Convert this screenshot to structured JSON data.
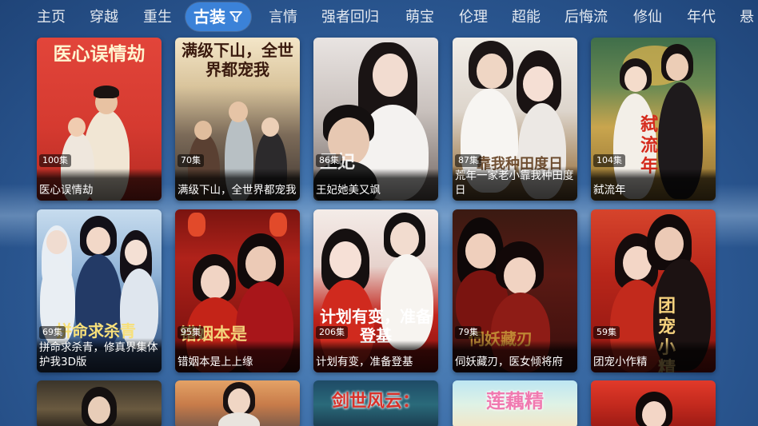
{
  "tabs": [
    {
      "label": "主页"
    },
    {
      "label": "穿越"
    },
    {
      "label": "重生"
    },
    {
      "label": "古装"
    },
    {
      "label": "言情"
    },
    {
      "label": "强者回归"
    },
    {
      "label": "萌宝"
    },
    {
      "label": "伦理"
    },
    {
      "label": "超能"
    },
    {
      "label": "后悔流"
    },
    {
      "label": "修仙"
    },
    {
      "label": "年代"
    },
    {
      "label": "悬"
    }
  ],
  "active_tab_index": 3,
  "cards": [
    {
      "episodes": "100集",
      "title": "医心误情劫",
      "poster_text": "医心误情劫"
    },
    {
      "episodes": "70集",
      "title": "满级下山，全世界都宠我",
      "poster_text": "满级下山，全世界都宠我"
    },
    {
      "episodes": "86集",
      "title": "王妃她美又飒",
      "poster_text": "王妃"
    },
    {
      "episodes": "87集",
      "title": "荒年一家老小靠我种田度日",
      "poster_text": "靠我种田度日"
    },
    {
      "episodes": "104集",
      "title": "弑流年",
      "poster_text": "弑流年"
    },
    {
      "episodes": "69集",
      "title": "拼命求杀青，修真界集体护我3D版",
      "poster_text": "拼命求杀青"
    },
    {
      "episodes": "95集",
      "title": "错姻本是上上缘",
      "poster_text": "错姻本是"
    },
    {
      "episodes": "206集",
      "title": "计划有变，准备登基",
      "poster_text": "计划有变，准备登基"
    },
    {
      "episodes": "79集",
      "title": "伺妖藏刃，医女倾将府",
      "poster_text": "伺妖藏刃"
    },
    {
      "episodes": "59集",
      "title": "团宠小作精",
      "poster_text": "团宠小精"
    },
    {
      "poster_text": ""
    },
    {
      "poster_text": ""
    },
    {
      "poster_text": "剑世风云："
    },
    {
      "poster_text": "莲藕精"
    },
    {
      "poster_text": ""
    }
  ]
}
